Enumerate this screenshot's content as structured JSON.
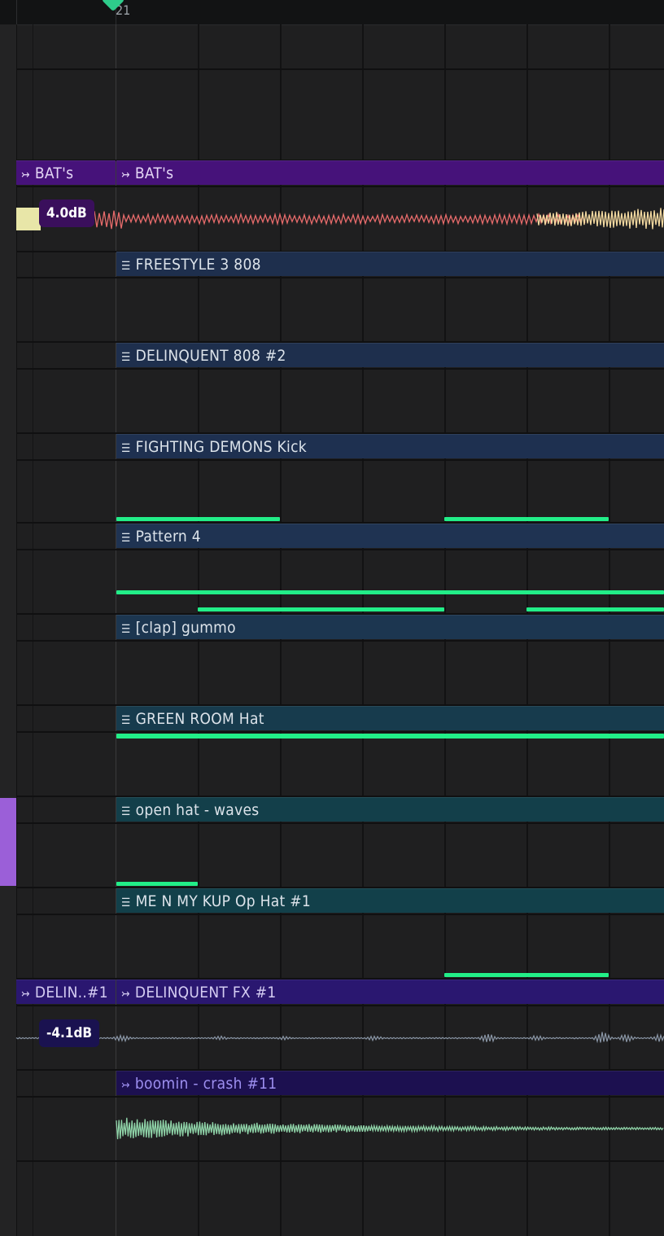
{
  "ruler": {
    "bar_number": "21"
  },
  "colors": {
    "pattern_clip": "#1d2f4f",
    "pattern_clip_teal": "#163a4a",
    "audio_clip_purple": "#46127a",
    "audio_clip_indigo": "#231668",
    "note": "#22ee88",
    "selected_track": "#9b5fd8"
  },
  "icons": {
    "pattern": "pattern-clip-icon",
    "audio": "audio-clip-icon"
  },
  "clips": {
    "bats_left": {
      "label": "BAT's",
      "type": "audio"
    },
    "bats_main": {
      "label": "BAT's",
      "type": "audio",
      "volume": "4.0dB"
    },
    "freestyle": {
      "label": "FREESTYLE 3 808",
      "type": "pattern"
    },
    "delinquent808": {
      "label": "DELINQUENT 808 #2",
      "type": "pattern"
    },
    "fighting_kick": {
      "label": "FIGHTING DEMONS Kick",
      "type": "pattern"
    },
    "pattern4": {
      "label": "Pattern 4",
      "type": "pattern"
    },
    "clap_gummo": {
      "label": "[clap] gummo",
      "type": "pattern"
    },
    "green_room_hat": {
      "label": "GREEN ROOM Hat",
      "type": "pattern"
    },
    "open_hat_waves": {
      "label": "open hat - waves",
      "type": "pattern"
    },
    "me_n_my_kup": {
      "label": "ME N MY KUP Op Hat #1",
      "type": "pattern"
    },
    "delin_left": {
      "label": "DELIN..#1",
      "type": "audio",
      "volume": "-4.1dB"
    },
    "delinquent_fx": {
      "label": "DELINQUENT FX #1",
      "type": "audio"
    },
    "boomin_crash": {
      "label": "boomin - crash #11",
      "type": "audio"
    }
  }
}
